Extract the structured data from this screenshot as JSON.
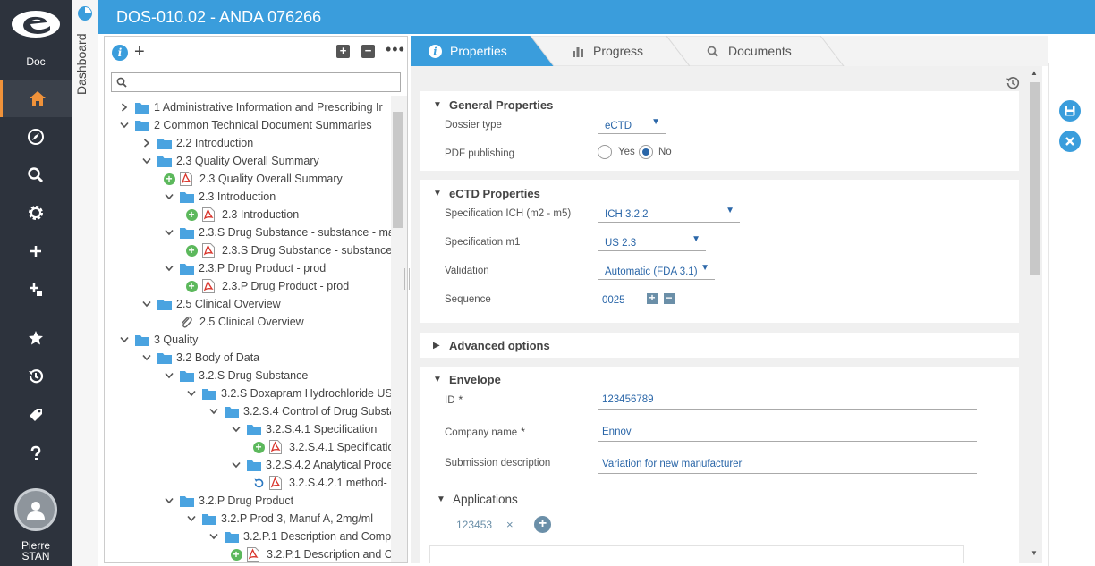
{
  "app": {
    "logo_label": "Doc",
    "user": {
      "first": "Pierre",
      "last": "STAN"
    }
  },
  "nav": [
    "home-icon",
    "compass-icon",
    "search-icon",
    "gear-icon",
    "plus-icon",
    "add-node-icon",
    "star-icon",
    "history-icon",
    "tag-icon",
    "help-icon"
  ],
  "dashboard_label": "Dashboard",
  "header": {
    "title": "DOS-010.02 - ANDA 076266"
  },
  "tree": {
    "search_placeholder": "",
    "rows": [
      {
        "label": "1 Administrative Information and Prescribing Ir",
        "kind": "folder",
        "chev": "right"
      },
      {
        "label": "2 Common Technical Document Summaries",
        "kind": "folder",
        "chev": "down"
      },
      {
        "label": "2.2 Introduction",
        "kind": "folder",
        "chev": "right"
      },
      {
        "label": "2.3 Quality Overall Summary",
        "kind": "folder",
        "chev": "down"
      },
      {
        "label": "2.3 Quality Overall Summary",
        "kind": "pdf",
        "chev": "add"
      },
      {
        "label": "2.3 Introduction",
        "kind": "folder",
        "chev": "down"
      },
      {
        "label": "2.3 Introduction",
        "kind": "pdf",
        "chev": "add"
      },
      {
        "label": "2.3.S Drug Substance - substance - ma",
        "kind": "folder",
        "chev": "down"
      },
      {
        "label": "2.3.S Drug Substance - substance",
        "kind": "pdf",
        "chev": "add"
      },
      {
        "label": "2.3.P Drug Product - prod",
        "kind": "folder",
        "chev": "down"
      },
      {
        "label": "2.3.P Drug Product - prod",
        "kind": "pdf",
        "chev": "add"
      },
      {
        "label": "2.5 Clinical Overview",
        "kind": "folder",
        "chev": "down"
      },
      {
        "label": "2.5 Clinical Overview",
        "kind": "clip",
        "chev": "none"
      },
      {
        "label": "3 Quality",
        "kind": "folder",
        "chev": "down"
      },
      {
        "label": "3.2 Body of Data",
        "kind": "folder",
        "chev": "down"
      },
      {
        "label": "3.2.S Drug Substance",
        "kind": "folder",
        "chev": "down"
      },
      {
        "label": "3.2.S Doxapram Hydrochloride US",
        "kind": "folder",
        "chev": "down"
      },
      {
        "label": "3.2.S.4 Control of Drug Substa",
        "kind": "folder",
        "chev": "down"
      },
      {
        "label": "3.2.S.4.1 Specification",
        "kind": "folder",
        "chev": "down"
      },
      {
        "label": "3.2.S.4.1 Specificatio",
        "kind": "pdf",
        "chev": "add"
      },
      {
        "label": "3.2.S.4.2 Analytical Proce",
        "kind": "folder",
        "chev": "down"
      },
      {
        "label": "3.2.S.4.2.1 method-",
        "kind": "pdf",
        "chev": "refresh"
      },
      {
        "label": "3.2.P Drug Product",
        "kind": "folder",
        "chev": "down"
      },
      {
        "label": "3.2.P Prod 3, Manuf A, 2mg/ml",
        "kind": "folder",
        "chev": "down"
      },
      {
        "label": "3.2.P.1 Description and Comp",
        "kind": "folder",
        "chev": "down"
      },
      {
        "label": "3.2.P.1 Description and C",
        "kind": "pdf",
        "chev": "add"
      }
    ]
  },
  "tabs": [
    {
      "label": "Properties",
      "icon": "info-icon",
      "active": true
    },
    {
      "label": "Progress",
      "icon": "bar-chart-icon",
      "active": false
    },
    {
      "label": "Documents",
      "icon": "search-icon",
      "active": false
    }
  ],
  "general": {
    "title": "General Properties",
    "dossier_type_label": "Dossier type",
    "dossier_type_value": "eCTD",
    "pdf_label": "PDF publishing",
    "yes": "Yes",
    "no": "No",
    "selected": "No"
  },
  "ectd": {
    "title": "eCTD Properties",
    "spec_ich_label": "Specification ICH (m2 - m5)",
    "spec_ich_value": "ICH 3.2.2",
    "spec_m1_label": "Specification m1",
    "spec_m1_value": "US 2.3",
    "validation_label": "Validation",
    "validation_value": "Automatic (FDA 3.1)",
    "sequence_label": "Sequence",
    "sequence_value": "0025"
  },
  "advanced": {
    "title": "Advanced options"
  },
  "envelope": {
    "title": "Envelope",
    "id_label": "ID",
    "id_value": "123456789",
    "company_label": "Company name",
    "company_value": "Ennov",
    "desc_label": "Submission description",
    "desc_value": "Variation for new manufacturer",
    "required_mark": "*"
  },
  "applications": {
    "title": "Applications",
    "chip": "123453",
    "remove": "×"
  }
}
